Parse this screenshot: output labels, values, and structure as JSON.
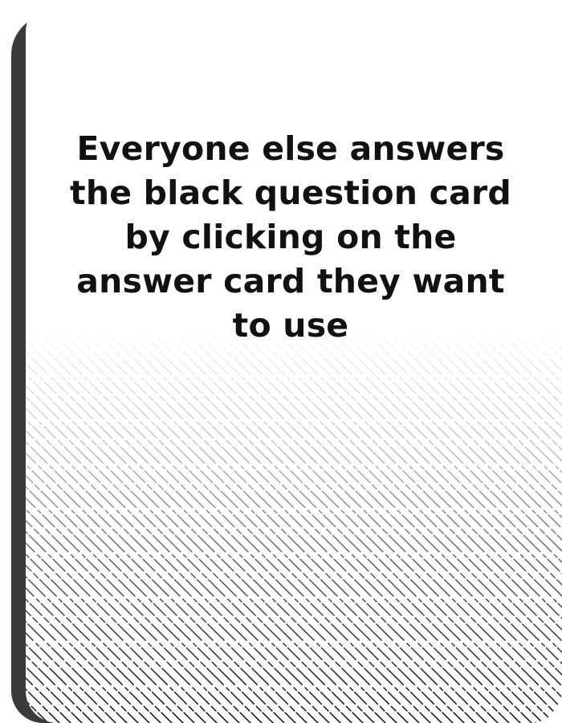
{
  "card": {
    "instruction_text": "Everyone else answers the black question card by clicking on the answer card they want to use"
  },
  "colors": {
    "background": "#ffffff",
    "card_edge": "#3a3a3a",
    "text": "#111111",
    "hatch": "#1a1a1a"
  }
}
